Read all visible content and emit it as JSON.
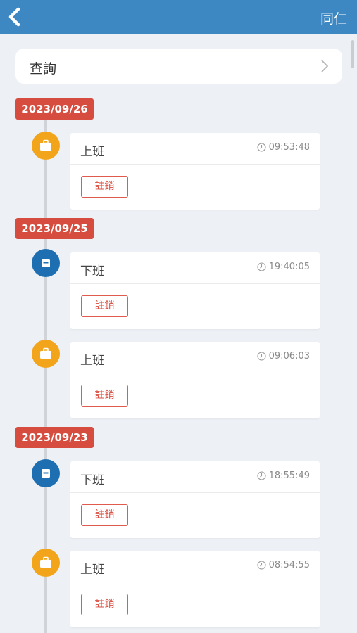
{
  "header": {
    "title": "同仁"
  },
  "search": {
    "label": "查詢"
  },
  "timeline": [
    {
      "date": "2023/09/26",
      "records": [
        {
          "type": "上班",
          "kind": "clock-in",
          "time": "09:53:48",
          "action": "註銷"
        }
      ]
    },
    {
      "date": "2023/09/25",
      "records": [
        {
          "type": "下班",
          "kind": "clock-out",
          "time": "19:40:05",
          "action": "註銷"
        },
        {
          "type": "上班",
          "kind": "clock-in",
          "time": "09:06:03",
          "action": "註銷"
        }
      ]
    },
    {
      "date": "2023/09/23",
      "records": [
        {
          "type": "下班",
          "kind": "clock-out",
          "time": "18:55:49",
          "action": "註銷"
        },
        {
          "type": "上班",
          "kind": "clock-in",
          "time": "08:54:55",
          "action": "註銷"
        }
      ]
    }
  ],
  "colors": {
    "header": "#3d88c3",
    "date_badge": "#d64c3e",
    "clock_in": "#f2a51b",
    "clock_out": "#1e6fb1",
    "cancel": "#d94b3d"
  }
}
